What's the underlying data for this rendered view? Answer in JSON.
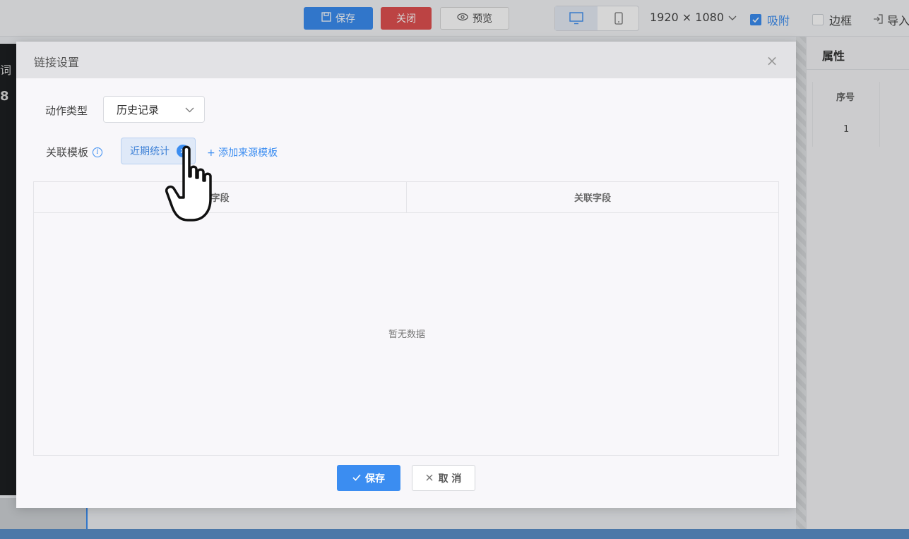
{
  "toolbar": {
    "save_label": "保存",
    "close_label": "关闭",
    "preview_label": "预览",
    "resolution": "1920 × 1080",
    "snap_label": "吸附",
    "border_label": "边框",
    "import_label": "导入",
    "snap_checked": true,
    "border_checked": false
  },
  "left_panel": {
    "text1": "词",
    "text2": "8"
  },
  "right_panel": {
    "title": "属性",
    "col_header": "序号",
    "cell_value": "1"
  },
  "modal": {
    "title": "链接设置",
    "action_type_label": "动作类型",
    "action_type_value": "历史记录",
    "template_label": "关联模板",
    "tag_label": "近期统计",
    "add_source_link": "+ 添加来源模板",
    "table": {
      "columns": [
        "字段",
        "关联字段"
      ],
      "empty_text": "暂无数据"
    },
    "save_button": "保存",
    "cancel_button": "取 消"
  },
  "colors": {
    "primary": "#3b8df1",
    "danger": "#e05050"
  }
}
